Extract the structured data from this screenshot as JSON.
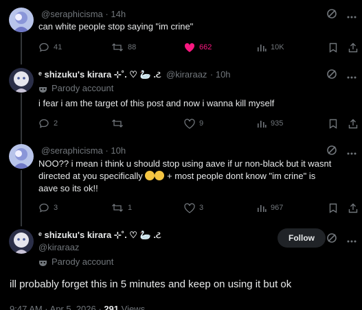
{
  "posts": [
    {
      "handle": "@seraphicisma",
      "time": "14h",
      "text": "can white people stop saying \"im crine\"",
      "replies": "41",
      "reposts": "88",
      "likes": "662",
      "views": "10K"
    },
    {
      "display_name": "ᵉ shizuku's kirara ⊹˚. ♡ 🦢 .ટ",
      "handle": "@kiraraaz",
      "time": "10h",
      "parody": "Parody account",
      "text": "i fear i am the target of this post and now i wanna kill myself",
      "replies": "2",
      "reposts": "",
      "likes": "9",
      "views": "935"
    },
    {
      "handle": "@seraphicisma",
      "time": "10h",
      "text_line1": "NOO?? i mean i think u should stop using aave if ur non-black but it wasnt",
      "text_line2a": "directed at you specifically",
      "text_line2b": "+ most people dont know \"im crine\" is",
      "text_line3": "aave so its ok!!",
      "replies": "3",
      "reposts": "1",
      "likes": "3",
      "views": "967"
    }
  ],
  "main_post": {
    "display_name": "ᵉ shizuku's kirara ⊹˚. ♡ 🦢 .ટ",
    "handle": "@kiraraaz",
    "parody": "Parody account",
    "follow_label": "Follow",
    "text": "ill probably forget this in 5 minutes and keep on using it but ok",
    "timestamp": "9:47 AM · Apr 5, 2026 · ",
    "views_count": "291",
    "views_label": " Views"
  },
  "colors": {
    "background": "#000000",
    "text": "#e7e9ea",
    "muted": "#71767b",
    "like_active": "#f91880"
  }
}
